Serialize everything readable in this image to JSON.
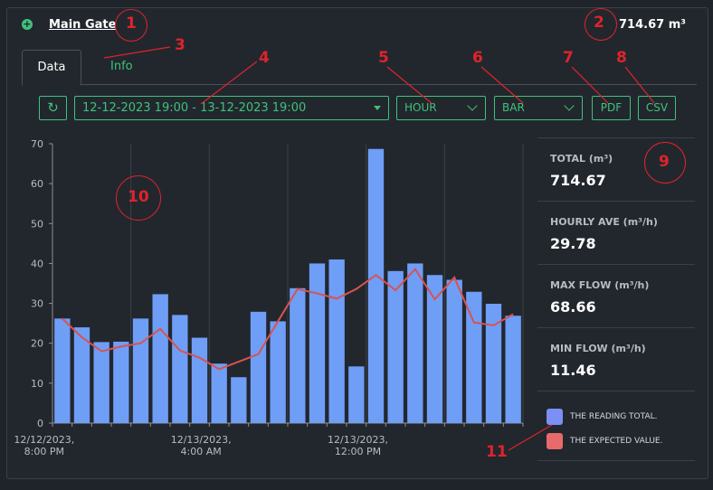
{
  "header": {
    "title": "Main Gate",
    "total": "714.67 m³"
  },
  "tabs": [
    {
      "label": "Data"
    },
    {
      "label": "Info"
    }
  ],
  "toolbar": {
    "date_range": "12-12-2023 19:00 - 13-12-2023 19:00",
    "interval": "HOUR",
    "chart_type": "BAR",
    "pdf": "PDF",
    "csv": "CSV"
  },
  "stats": [
    {
      "label": "TOTAL (m³)",
      "value": "714.67"
    },
    {
      "label": "HOURLY AVE (m³/h)",
      "value": "29.78"
    },
    {
      "label": "MAX FLOW (m³/h)",
      "value": "68.66"
    },
    {
      "label": "MIN FLOW (m³/h)",
      "value": "11.46"
    }
  ],
  "legend": [
    {
      "label": "THE READING TOTAL.",
      "color": "#7b8ff5"
    },
    {
      "label": "THE EXPECTED VALUE.",
      "color": "#e86a6a"
    }
  ],
  "chart_data": {
    "type": "bar",
    "bar_color": "#6f9ef7",
    "line_color": "#d9534f",
    "ylim": [
      0,
      70
    ],
    "yticks": [
      0,
      10,
      20,
      30,
      40,
      50,
      60,
      70
    ],
    "x_tick_labels": [
      {
        "index": 0,
        "lines": [
          "12/12/2023,",
          "8:00 PM"
        ]
      },
      {
        "index": 8,
        "lines": [
          "12/13/2023,",
          "4:00 AM"
        ]
      },
      {
        "index": 16,
        "lines": [
          "12/13/2023,",
          "12:00 PM"
        ]
      }
    ],
    "series": [
      {
        "kind": "bar",
        "values": [
          26.2,
          24.0,
          20.3,
          20.4,
          26.2,
          32.3,
          27.1,
          21.4,
          14.9,
          11.5,
          27.9,
          25.5,
          33.8,
          40.0,
          41.0,
          14.2,
          68.7,
          38.1,
          40.0,
          37.1,
          35.9,
          32.9,
          29.9,
          26.9
        ]
      },
      {
        "kind": "line",
        "values": [
          26.2,
          21.5,
          18.0,
          19.2,
          20.0,
          23.6,
          18.2,
          16.4,
          13.5,
          15.4,
          17.3,
          25.5,
          33.6,
          32.5,
          31.2,
          33.6,
          37.1,
          33.3,
          38.6,
          31.0,
          36.5,
          25.2,
          24.5,
          27.3
        ]
      }
    ]
  },
  "annotations": [
    "1",
    "2",
    "3",
    "4",
    "5",
    "6",
    "7",
    "8",
    "9",
    "10",
    "11"
  ]
}
